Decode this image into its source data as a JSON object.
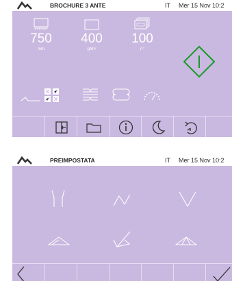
{
  "screen1": {
    "header": {
      "title": "BROCHURE 3 ANTE",
      "language": "IT",
      "datetime": "Mer 15 Nov 10:2"
    },
    "params": [
      {
        "icon": "length-ruler-icon",
        "value": "750",
        "unit": "mm"
      },
      {
        "icon": "paper-weight-icon",
        "value": "400",
        "unit": "g/m²"
      },
      {
        "icon": "sheet-counter-icon",
        "value": "100",
        "unit": "n°"
      }
    ],
    "start_button_icon": "start-diamond-icon",
    "tool_icons": [
      "fold-profile-icon",
      "grid-options-icon",
      "crease-lines-icon",
      "rollers-icon",
      "gauge-icon"
    ],
    "toolbar_icons": [
      "exit-icon",
      "folder-icon",
      "info-icon",
      "sleep-moon-icon",
      "undo-icon"
    ],
    "colors": {
      "panel": "#c9b8df",
      "accent_green": "#1a9a2a",
      "bar_border": "#e7dcf3"
    }
  },
  "screen2": {
    "header": {
      "title": "PREIMPOSTATA",
      "language": "IT",
      "datetime": "Mer 15 Nov 10:2"
    },
    "fold_options": [
      "fold-u-icon",
      "fold-n-icon",
      "fold-v-icon",
      "fold-triangle-icon",
      "fold-check-icon",
      "fold-roof-icon"
    ],
    "toolbar_icons": [
      "back-arrow-icon",
      "confirm-check-icon"
    ]
  }
}
